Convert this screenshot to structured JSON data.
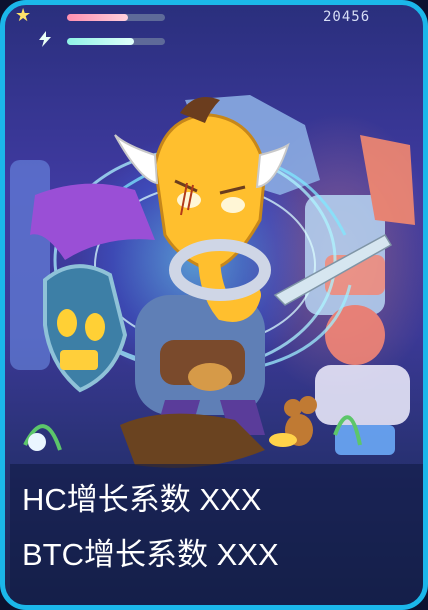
{
  "hud": {
    "score": "20456",
    "health_fraction": 0.62,
    "energy_fraction": 0.68,
    "star_icon": "star-icon",
    "bolt_icon": "lightning-bolt-icon"
  },
  "captions": {
    "line1": "HC增长系数 XXX",
    "line2": "BTC增长系数 XXX"
  },
  "colors": {
    "border": "#1bb7ea",
    "caption_text": "#ffffff"
  }
}
